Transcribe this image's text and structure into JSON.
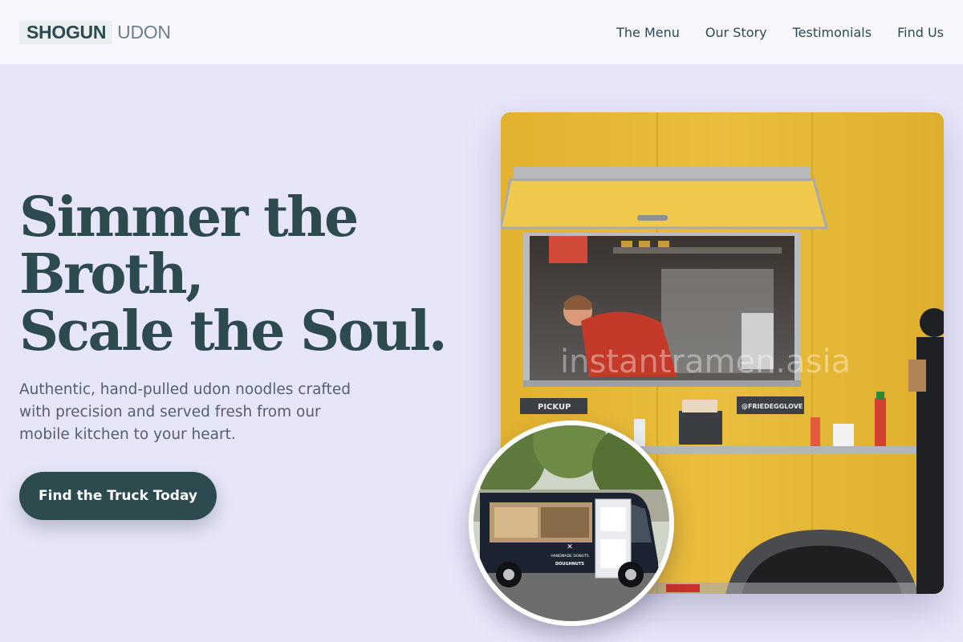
{
  "header": {
    "logo_strong": "SHOGUN",
    "logo_light": "UDON",
    "nav": [
      {
        "label": "The Menu"
      },
      {
        "label": "Our Story"
      },
      {
        "label": "Testimonials"
      },
      {
        "label": "Find Us"
      }
    ]
  },
  "hero": {
    "headline_lines": [
      "Simmer the",
      "Broth,",
      "Scale the Soul."
    ],
    "subtext": "Authentic, hand-pulled udon noodles crafted with precision and served fresh from our mobile kitchen to your heart.",
    "cta_label": "Find the Truck Today"
  },
  "images": {
    "main_watermark": "instantramen.asia",
    "main_truck_sign_left": "PICKUP",
    "main_truck_sign_right": "@FRIEDEGGLOVE",
    "circle_truck_text_1": "HANDMADE DONUTS",
    "circle_truck_text_2": "DOUGHNUTS"
  },
  "colors": {
    "page_background": "#e7e5f8",
    "header_background": "#f6f6fc",
    "primary": "#2d4a4f",
    "body_text": "#55606c",
    "truck_yellow": "#e6b935"
  }
}
